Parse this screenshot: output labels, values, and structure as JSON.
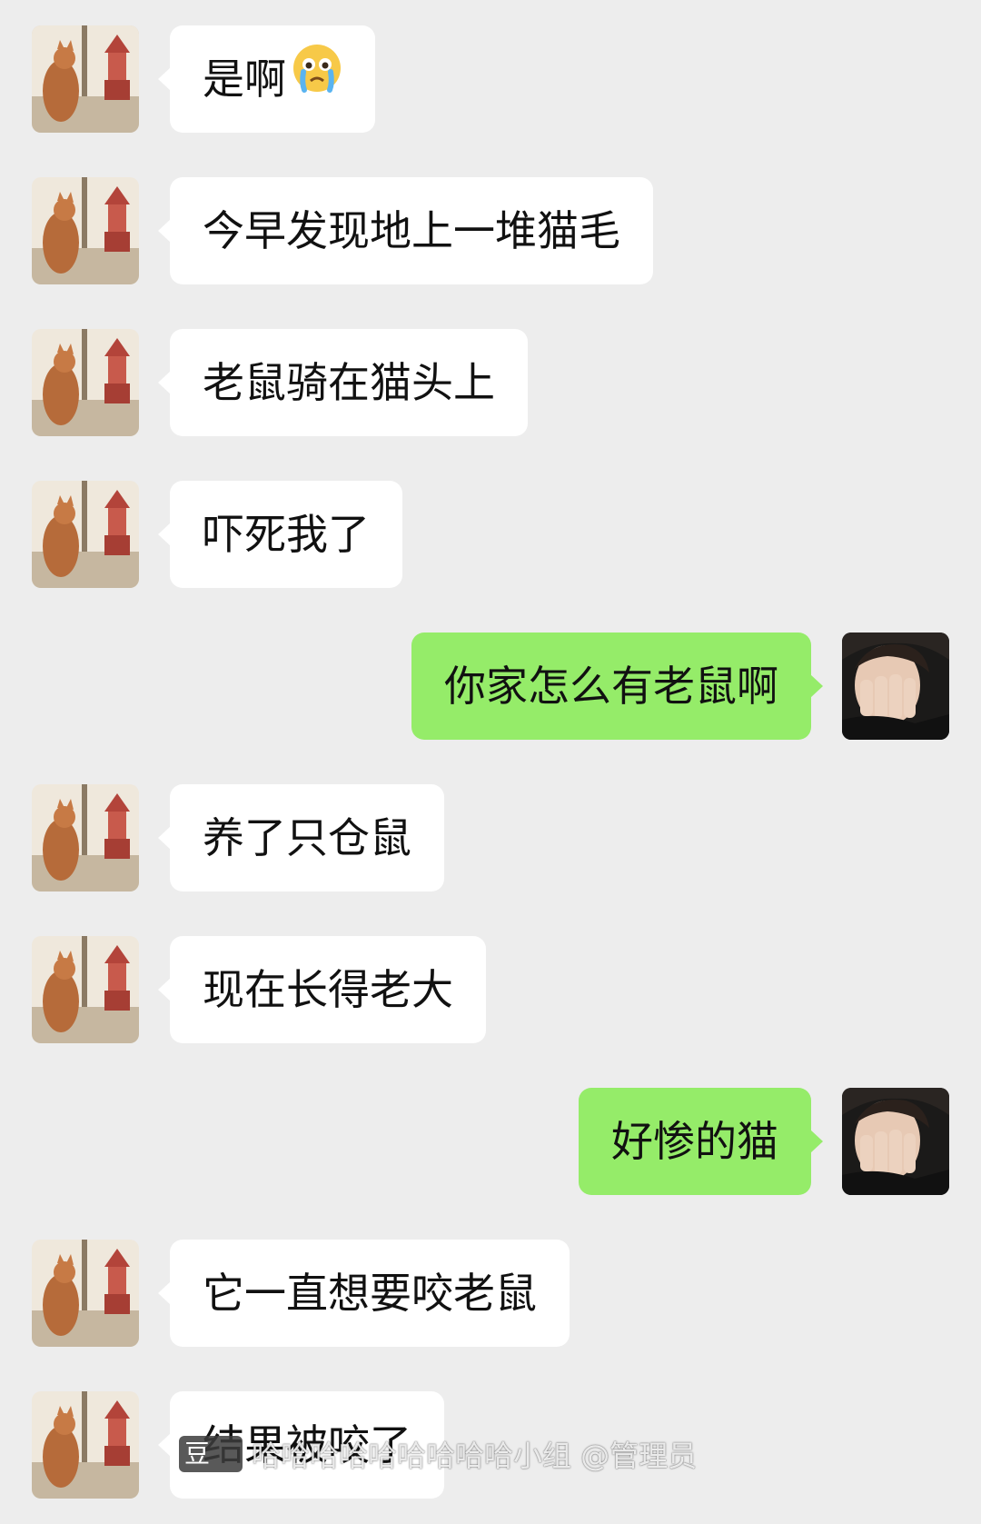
{
  "messages": [
    {
      "side": "left",
      "text": "是啊",
      "emoji": "crying-face-emoji"
    },
    {
      "side": "left",
      "text": "今早发现地上一堆猫毛"
    },
    {
      "side": "left",
      "text": "老鼠骑在猫头上"
    },
    {
      "side": "left",
      "text": "吓死我了"
    },
    {
      "side": "right",
      "text": "你家怎么有老鼠啊"
    },
    {
      "side": "left",
      "text": "养了只仓鼠"
    },
    {
      "side": "left",
      "text": "现在长得老大"
    },
    {
      "side": "right",
      "text": "好惨的猫"
    },
    {
      "side": "left",
      "text": "它一直想要咬老鼠"
    },
    {
      "side": "left",
      "text": "结果被咬了"
    }
  ],
  "watermark": {
    "logo": "豆",
    "text": "哈哈哈哈哈哈哈哈哈小组 @管理员"
  },
  "colors": {
    "background": "#ededed",
    "incoming_bubble": "#ffffff",
    "outgoing_bubble": "#95ec69"
  }
}
